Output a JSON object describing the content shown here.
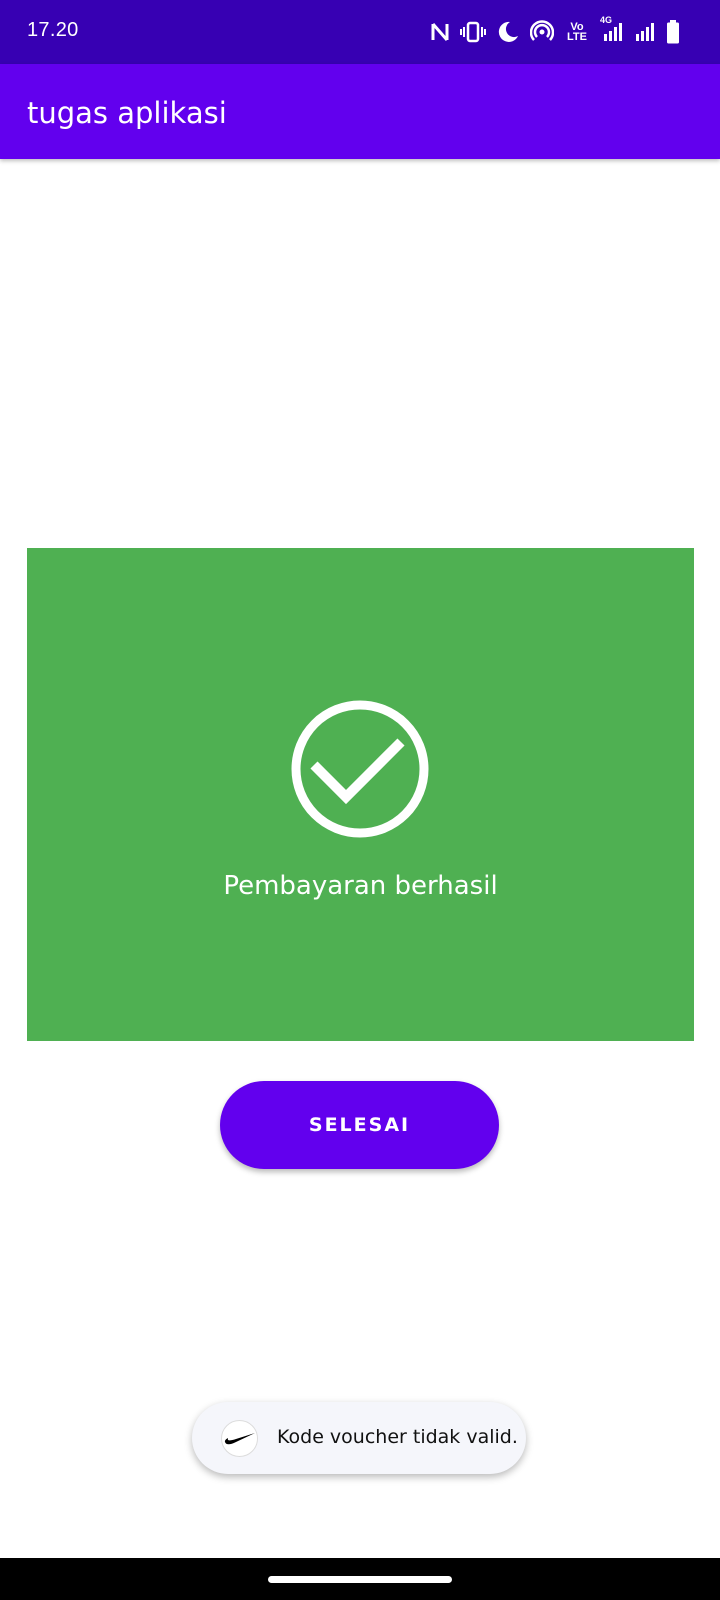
{
  "status_bar": {
    "time": "17.20",
    "volte_label": "Vo LTE",
    "network_label": "4G",
    "icons": [
      "nfc-icon",
      "vibrate-icon",
      "do-not-disturb-moon-icon",
      "hotspot-icon",
      "volte-icon",
      "signal-sim1-icon",
      "signal-sim2-icon",
      "battery-icon"
    ]
  },
  "app_bar": {
    "title": "tugas aplikasi"
  },
  "success_panel": {
    "message": "Pembayaran berhasil",
    "background_color": "#4FB052",
    "icon": "check-circle-icon"
  },
  "actions": {
    "done_label": "SELESAI"
  },
  "toast": {
    "message": "Kode voucher tidak valid.",
    "app_icon": "nike-swoosh-icon"
  },
  "colors": {
    "status_bar": "#3700B3",
    "primary": "#6200EE",
    "success": "#4FB052"
  }
}
